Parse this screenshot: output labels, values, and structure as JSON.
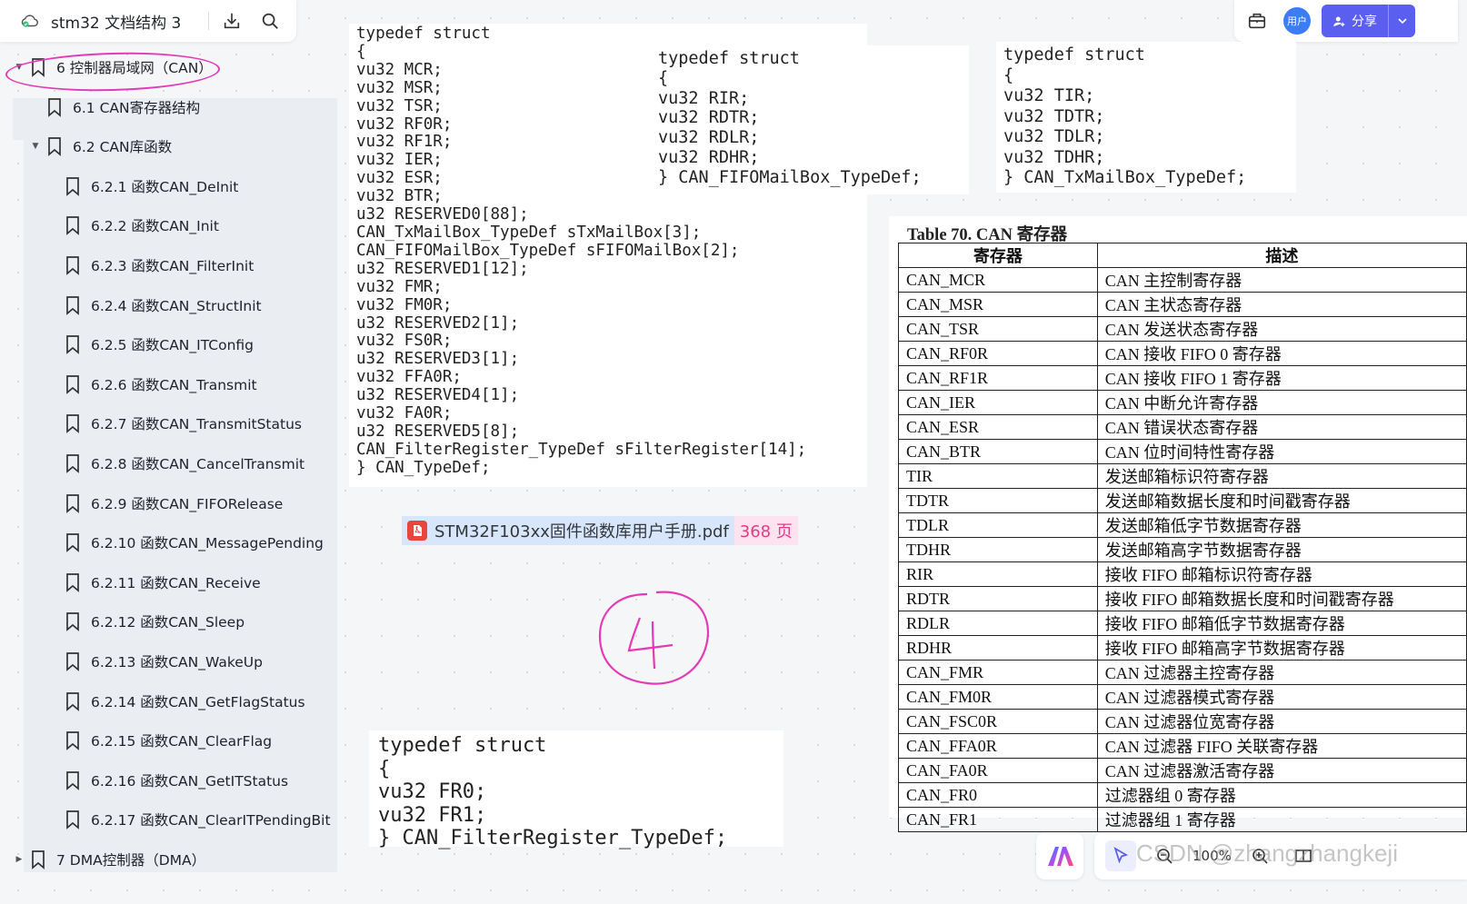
{
  "app": {
    "doc_title": "stm32 文档结构 3"
  },
  "toolbar_right": {
    "avatar_text": "用户",
    "share_label": "分享",
    "accent": "#5b5ff0"
  },
  "outline": {
    "items": [
      {
        "level": 1,
        "expanded": true,
        "label": "6 控制器局域网（CAN）"
      },
      {
        "level": 2,
        "label": "6.1 CAN寄存器结构"
      },
      {
        "level": 2,
        "expanded": true,
        "label": "6.2 CAN库函数"
      },
      {
        "level": 3,
        "label": "6.2.1 函数CAN_DeInit"
      },
      {
        "level": 3,
        "label": "6.2.2 函数CAN_Init"
      },
      {
        "level": 3,
        "label": "6.2.3 函数CAN_FilterInit"
      },
      {
        "level": 3,
        "label": "6.2.4 函数CAN_StructInit"
      },
      {
        "level": 3,
        "label": "6.2.5 函数CAN_ITConfig"
      },
      {
        "level": 3,
        "label": "6.2.6 函数CAN_Transmit"
      },
      {
        "level": 3,
        "label": "6.2.7 函数CAN_TransmitStatus"
      },
      {
        "level": 3,
        "label": "6.2.8 函数CAN_CancelTransmit"
      },
      {
        "level": 3,
        "label": "6.2.9 函数CAN_FIFORelease"
      },
      {
        "level": 3,
        "label": "6.2.10 函数CAN_MessagePending"
      },
      {
        "level": 3,
        "label": "6.2.11 函数CAN_Receive"
      },
      {
        "level": 3,
        "label": "6.2.12 函数CAN_Sleep"
      },
      {
        "level": 3,
        "label": "6.2.13 函数CAN_WakeUp"
      },
      {
        "level": 3,
        "label": "6.2.14 函数CAN_GetFlagStatus"
      },
      {
        "level": 3,
        "label": "6.2.15 函数CAN_ClearFlag"
      },
      {
        "level": 3,
        "label": "6.2.16 函数CAN_GetITStatus"
      },
      {
        "level": 3,
        "label": "6.2.17 函数CAN_ClearITPendingBit"
      },
      {
        "level": 1,
        "expanded": false,
        "label": "7 DMA控制器（DMA）"
      }
    ]
  },
  "code_main": [
    "typedef struct",
    "{",
    "vu32 MCR;",
    "vu32 MSR;",
    "vu32 TSR;",
    "vu32 RF0R;",
    "vu32 RF1R;",
    "vu32 IER;",
    "vu32 ESR;",
    "vu32 BTR;",
    "u32 RESERVED0[88];",
    "CAN_TxMailBox_TypeDef sTxMailBox[3];",
    "CAN_FIFOMailBox_TypeDef sFIFOMailBox[2];",
    "u32 RESERVED1[12];",
    "vu32 FMR;",
    "vu32 FM0R;",
    "u32 RESERVED2[1];",
    "vu32 FS0R;",
    "u32 RESERVED3[1];",
    "vu32 FFA0R;",
    "u32 RESERVED4[1];",
    "vu32 FA0R;",
    "u32 RESERVED5[8];",
    "CAN_FilterRegister_TypeDef sFilterRegister[14];",
    "} CAN_TypeDef;"
  ],
  "code_fifo": [
    "typedef struct",
    "{",
    "vu32 RIR;",
    "vu32 RDTR;",
    "vu32 RDLR;",
    "vu32 RDHR;",
    "} CAN_FIFOMailBox_TypeDef;"
  ],
  "code_tx": [
    "typedef struct",
    "{",
    "vu32 TIR;",
    "vu32 TDTR;",
    "vu32 TDLR;",
    "vu32 TDHR;",
    "} CAN_TxMailBox_TypeDef;"
  ],
  "code_filter": [
    "typedef struct",
    "{",
    "vu32 FR0;",
    "vu32 FR1;",
    "} CAN_FilterRegister_TypeDef;"
  ],
  "file_chip": {
    "name": "STM32F103xx固件函数库用户手册.pdf",
    "pages": "368 页"
  },
  "annotation_colors": {
    "pen": "#e23bb8"
  },
  "register_table": {
    "title": "Table 70. CAN 寄存器",
    "headers": [
      "寄存器",
      "描述"
    ],
    "rows": [
      [
        "CAN_MCR",
        "CAN 主控制寄存器"
      ],
      [
        "CAN_MSR",
        "CAN 主状态寄存器"
      ],
      [
        "CAN_TSR",
        "CAN 发送状态寄存器"
      ],
      [
        "CAN_RF0R",
        "CAN 接收 FIFO 0 寄存器"
      ],
      [
        "CAN_RF1R",
        "CAN 接收 FIFO 1 寄存器"
      ],
      [
        "CAN_IER",
        "CAN 中断允许寄存器"
      ],
      [
        "CAN_ESR",
        "CAN 错误状态寄存器"
      ],
      [
        "CAN_BTR",
        "CAN 位时间特性寄存器"
      ],
      [
        "TIR",
        "发送邮箱标识符寄存器"
      ],
      [
        "TDTR",
        "发送邮箱数据长度和时间戳寄存器"
      ],
      [
        "TDLR",
        "发送邮箱低字节数据寄存器"
      ],
      [
        "TDHR",
        "发送邮箱高字节数据寄存器"
      ],
      [
        "RIR",
        "接收 FIFO 邮箱标识符寄存器"
      ],
      [
        "RDTR",
        "接收 FIFO 邮箱数据长度和时间戳寄存器"
      ],
      [
        "RDLR",
        "接收 FIFO 邮箱低字节数据寄存器"
      ],
      [
        "RDHR",
        "接收 FIFO 邮箱高字节数据寄存器"
      ],
      [
        "CAN_FMR",
        "CAN 过滤器主控寄存器"
      ],
      [
        "CAN_FM0R",
        "CAN 过滤器模式寄存器"
      ],
      [
        "CAN_FSC0R",
        "CAN 过滤器位宽寄存器"
      ],
      [
        "CAN_FFA0R",
        "CAN 过滤器 FIFO 关联寄存器"
      ],
      [
        "CAN_FA0R",
        "CAN 过滤器激活寄存器"
      ],
      [
        "CAN_FR0",
        "过滤器组 0 寄存器"
      ],
      [
        "CAN_FR1",
        "过滤器组 1 寄存器"
      ]
    ]
  },
  "bottom_toolbar": {
    "zoom": "100%"
  },
  "watermark": "CSDN @zhangzhangkeji"
}
